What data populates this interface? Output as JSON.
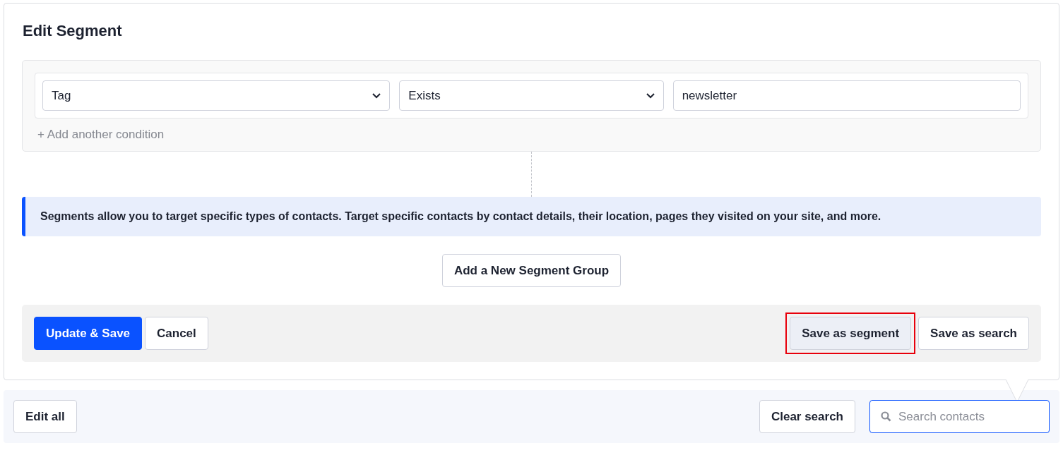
{
  "panel": {
    "title": "Edit Segment",
    "condition": {
      "field": "Tag",
      "operator": "Exists",
      "value": "newsletter"
    },
    "add_condition": "+ Add another condition",
    "info": "Segments allow you to target specific types of contacts. Target specific contacts by contact details, their location, pages they visited on your site, and more.",
    "add_group": "Add a New Segment Group",
    "footer_left": [
      {
        "label": "Update & Save",
        "kind": "primary"
      },
      {
        "label": "Cancel",
        "kind": "secondary"
      }
    ],
    "footer_right": [
      {
        "label": "Save as segment",
        "highlighted": true
      },
      {
        "label": "Save as search",
        "highlighted": false
      }
    ]
  },
  "toolbar": {
    "edit_all": "Edit all",
    "clear_search": "Clear search",
    "search": {
      "placeholder": "Search contacts",
      "focused": true
    }
  }
}
